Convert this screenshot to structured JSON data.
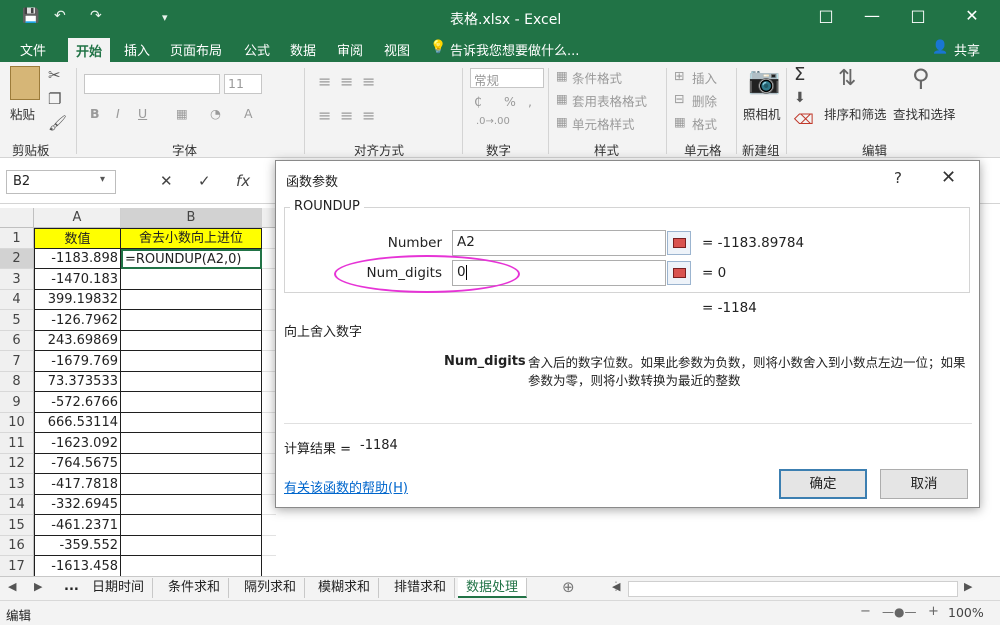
{
  "window": {
    "title": "表格.xlsx - Excel",
    "quick_access": [
      "save-icon",
      "undo-icon",
      "redo-icon",
      "customize-icon"
    ]
  },
  "tabs": [
    "文件",
    "开始",
    "插入",
    "页面布局",
    "公式",
    "数据",
    "审阅",
    "视图"
  ],
  "active_tab": "开始",
  "tell_me": "告诉我您想要做什么...",
  "share": "共享",
  "ribbon": {
    "clipboard": {
      "paste": "粘贴",
      "label": "剪贴板"
    },
    "font": {
      "size": "11",
      "label": "字体"
    },
    "alignment": {
      "label": "对齐方式"
    },
    "number": {
      "format": "常规",
      "label": "数字"
    },
    "styles": {
      "conditional": "条件格式",
      "table": "套用表格格式",
      "cell": "单元格样式",
      "label": "样式"
    },
    "cells": {
      "insert": "插入",
      "delete": "删除",
      "format": "格式",
      "label": "单元格"
    },
    "newgroup": {
      "camera": "照相机",
      "label": "新建组"
    },
    "editing": {
      "sort": "排序和筛选",
      "find": "查找和选择",
      "label": "编辑"
    }
  },
  "namebox": "B2",
  "columns": [
    "A",
    "B"
  ],
  "rows": [
    {
      "num": "1",
      "a": "数值",
      "b": "舍去小数向上进位"
    },
    {
      "num": "2",
      "a": "-1183.898",
      "b": "=ROUNDUP(A2,0)"
    },
    {
      "num": "3",
      "a": "-1470.183",
      "b": ""
    },
    {
      "num": "4",
      "a": "399.19832",
      "b": ""
    },
    {
      "num": "5",
      "a": "-126.7962",
      "b": ""
    },
    {
      "num": "6",
      "a": "243.69869",
      "b": ""
    },
    {
      "num": "7",
      "a": "-1679.769",
      "b": ""
    },
    {
      "num": "8",
      "a": "73.373533",
      "b": ""
    },
    {
      "num": "9",
      "a": "-572.6766",
      "b": ""
    },
    {
      "num": "10",
      "a": "666.53114",
      "b": ""
    },
    {
      "num": "11",
      "a": "-1623.092",
      "b": ""
    },
    {
      "num": "12",
      "a": "-764.5675",
      "b": ""
    },
    {
      "num": "13",
      "a": "-417.7818",
      "b": ""
    },
    {
      "num": "14",
      "a": "-332.6945",
      "b": ""
    },
    {
      "num": "15",
      "a": "-461.2371",
      "b": ""
    },
    {
      "num": "16",
      "a": "-359.552",
      "b": ""
    },
    {
      "num": "17",
      "a": "-1613.458",
      "b": ""
    }
  ],
  "dialog": {
    "title": "函数参数",
    "help_glyph": "?",
    "close_glyph": "✕",
    "function_name": "ROUNDUP",
    "args": [
      {
        "label": "Number",
        "value": "A2",
        "result": "=  -1183.89784"
      },
      {
        "label": "Num_digits",
        "value": "0",
        "result": "=  0"
      }
    ],
    "overall_result": "=  -1184",
    "description": "向上舍入数字",
    "param_name": "Num_digits",
    "param_help": "舍入后的数字位数。如果此参数为负数，则将小数舍入到小数点左边一位；如果参数为零，则将小数转换为最近的整数",
    "calc_label": "计算结果 =",
    "calc_value": "-1184",
    "help_link": "有关该函数的帮助(H)",
    "ok": "确定",
    "cancel": "取消"
  },
  "sheets": [
    "日期时间",
    "条件求和",
    "隔列求和",
    "模糊求和",
    "排错求和",
    "数据处理"
  ],
  "active_sheet": "数据处理",
  "sheet_ellipsis": "...",
  "status": {
    "mode": "编辑",
    "zoom": "100%"
  },
  "colors": {
    "excel_green": "#217346",
    "header_yellow": "#ffff00",
    "highlight_ellipse": "#e633d6"
  }
}
